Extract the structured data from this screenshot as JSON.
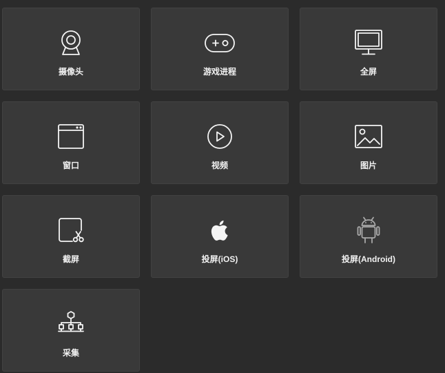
{
  "sources": [
    {
      "key": "camera",
      "label": "摄像头",
      "icon": "webcam-icon"
    },
    {
      "key": "game",
      "label": "游戏进程",
      "icon": "gamepad-icon"
    },
    {
      "key": "fullscreen",
      "label": "全屏",
      "icon": "monitor-icon"
    },
    {
      "key": "window",
      "label": "窗口",
      "icon": "window-icon"
    },
    {
      "key": "video",
      "label": "视频",
      "icon": "play-circle-icon"
    },
    {
      "key": "image",
      "label": "图片",
      "icon": "image-icon"
    },
    {
      "key": "screenshot",
      "label": "截屏",
      "icon": "crop-scissors-icon"
    },
    {
      "key": "ios",
      "label": "投屏(iOS)",
      "icon": "apple-icon"
    },
    {
      "key": "android",
      "label": "投屏(Android)",
      "icon": "android-icon"
    },
    {
      "key": "capture",
      "label": "采集",
      "icon": "network-tree-icon"
    }
  ],
  "colors": {
    "background": "#2b2b2b",
    "tile": "#393939",
    "tile_border": "#424242",
    "icon": "#f5f5f5",
    "icon_dim": "#a9a9a9",
    "text": "#f2f2f2"
  }
}
